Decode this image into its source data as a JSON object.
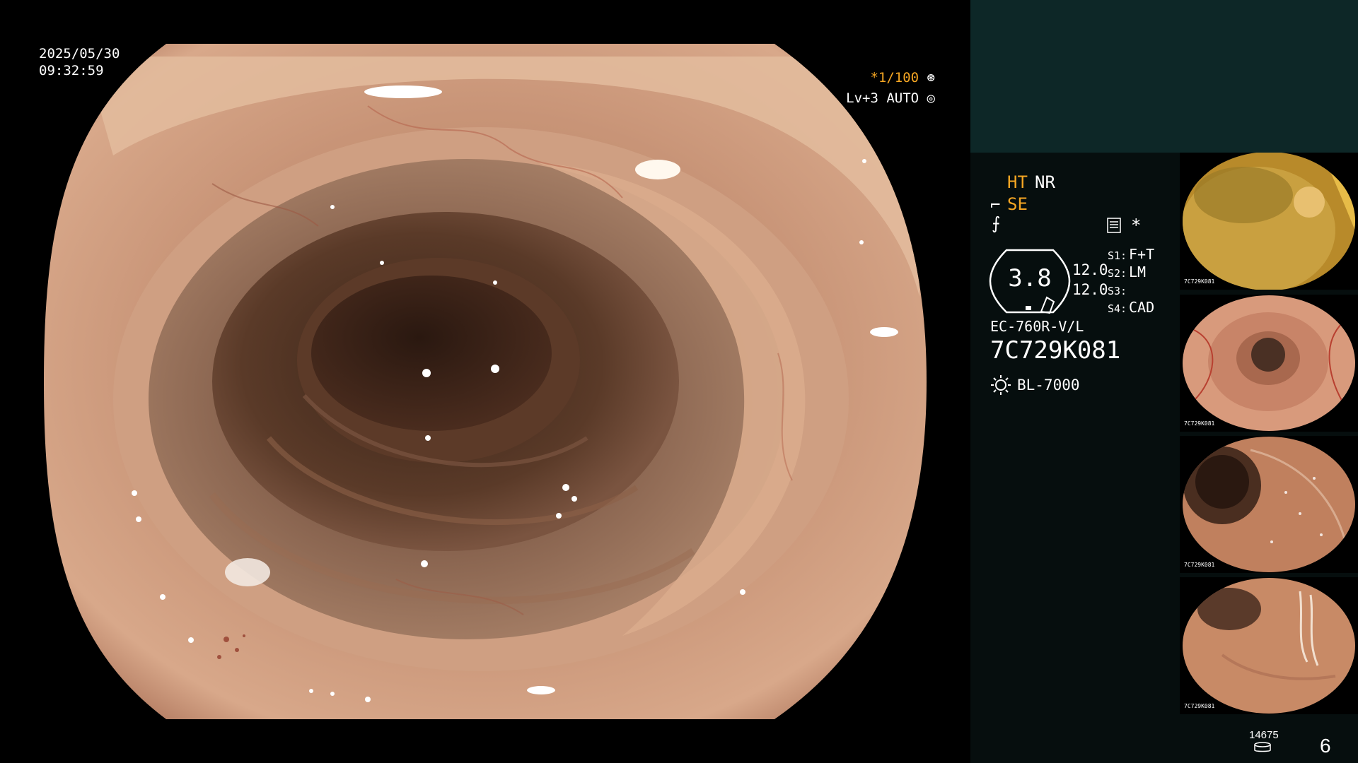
{
  "osd": {
    "date": "2025/05/30",
    "time": "09:32:59",
    "shutter": "*1/100",
    "level": "Lv+3 AUTO"
  },
  "panel": {
    "ht": "HT",
    "nr": "NR",
    "se": "SE",
    "star": "*",
    "gauge_value": "3.8",
    "value1": "12.0",
    "value2": "12.0",
    "slots": [
      {
        "label": "S1:",
        "value": "F+T"
      },
      {
        "label": "S2:",
        "value": "LM"
      },
      {
        "label": "S3:",
        "value": ""
      },
      {
        "label": "S4:",
        "value": "CAD"
      }
    ],
    "scope_model": "EC-760R-V/L",
    "scope_serial": "7C729K081",
    "light_source": "BL-7000",
    "image_count": "14675",
    "page_number": "6"
  },
  "thumbnails": [
    {
      "caption": "7C729K081"
    },
    {
      "caption": "7C729K081"
    },
    {
      "caption": "7C729K081"
    },
    {
      "caption": "7C729K081"
    }
  ],
  "colors": {
    "accent": "#f5a623",
    "panel_top": "#0d2727",
    "panel_bg": "#060e0e"
  },
  "icons": [
    "shutter-icon",
    "auto-icon",
    "se-icon",
    "enhance-icon",
    "document-icon",
    "light-source-icon",
    "storage-icon"
  ]
}
